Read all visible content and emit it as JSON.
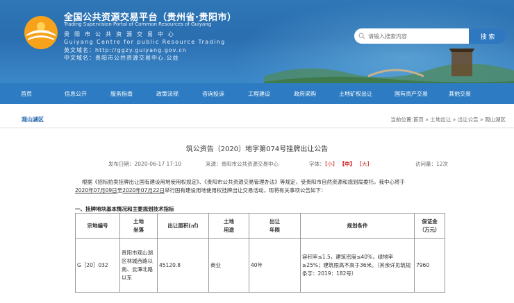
{
  "header": {
    "title_cn": "全国公共资源交易平台（贵州省·贵阳市）",
    "title_en": "Trading Supervision Portal of Common Resources of Guiyang",
    "info_line1": "贵阳市公共资源交易中心",
    "info_line2": "Guiyang Centre for public Resource Trading",
    "info_line3": "英文域名：http://ggzy.guiyang.gov.cn",
    "info_line4": "中文域名：贵阳市公共资源交易中心.公益",
    "search": {
      "placeholder": "请输入搜索内容",
      "button_label": "搜 索"
    }
  },
  "nav": {
    "items": [
      "首页",
      "信息公开",
      "服务指南",
      "政策法规",
      "咨询投诉",
      "工程建设",
      "政府采购",
      "土地矿权出让",
      "国有资产交易",
      "其他交易"
    ]
  },
  "breadcrumb": {
    "section": "观山湖区",
    "path": "当前位置:首页 » 土地出让 » 出让公告 » 观山湖区"
  },
  "article": {
    "title": "筑公资告〔2020〕地字第074号挂牌出让公告",
    "publish_date": "发布日期：2020-06-17 17:10",
    "source": "来源：贵阳市公共资源交易中心",
    "font_size_label": "字体：",
    "font_small": "【小】",
    "font_medium": "【中】",
    "font_large": "【大】",
    "views": "访问量：12次",
    "para1": "根据《招标拍卖挂牌出让国有建设用地使用权规定》、《贵阳市公共资源交易管理办法》等规定，受贵阳市自然资源和规划局委托，我中心将于",
    "para2_date1": "2020年07月09日",
    "para2_to": "至",
    "para2_date2": "2020年07月22日",
    "para2_rest": "举行国有建设用地使用权挂牌出让交易活动，现将有关事项公告如下：",
    "subhead": "一、挂牌地块基本情况和主要规划技术指标"
  },
  "table": {
    "headers": [
      "宗地编号",
      "土地\n坐落",
      "出让面积(㎡)",
      "土地\n用途",
      "出让\n年限",
      "规划条件",
      "保证金\n（万元）"
    ],
    "rows": [
      {
        "id": "G［20］032",
        "location": "贵阳市观山湖区林城西路以南、云潭北路以东",
        "area": "45120.8",
        "use": "商业",
        "years": "40年",
        "conditions": "容积率≤1.5，建筑密度≤40%，绿地率≥25%；建筑限高不高于36米。（其余详见筑规条字：2019：182号）",
        "deposit": "7960"
      }
    ]
  },
  "colors": {
    "header_blue": "#2f77b7",
    "nav_blue": "#2d7cc3",
    "link_blue": "#1a5fa8",
    "accent_red": "#cc0000"
  }
}
